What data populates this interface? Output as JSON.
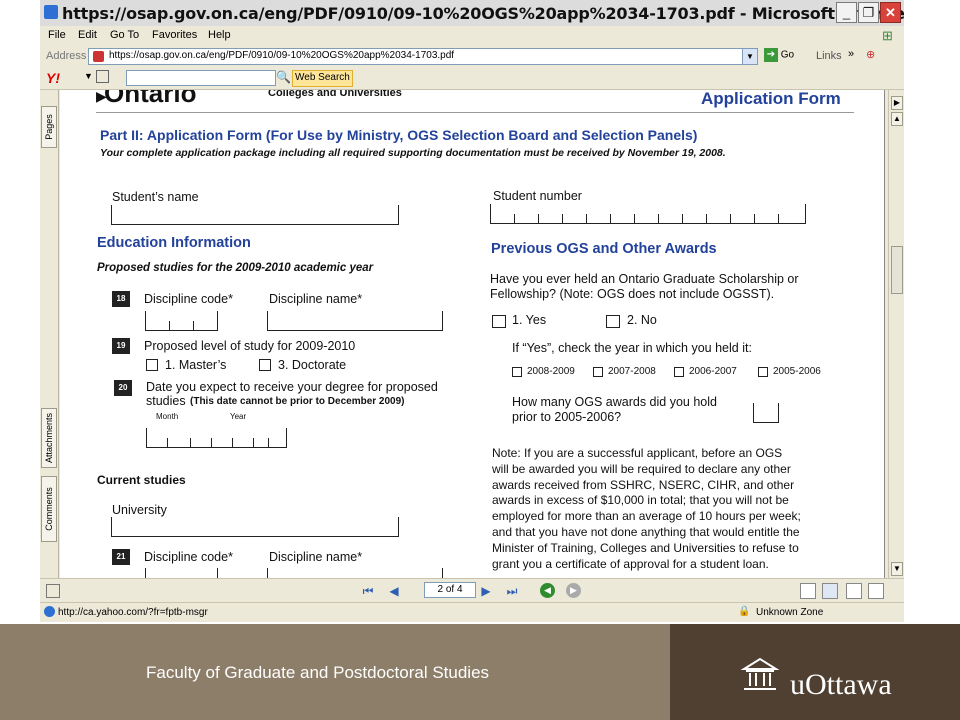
{
  "window": {
    "title": "https://osap.gov.on.ca/eng/PDF/0910/09-10%20OGS%20app%2034-1703.pdf - Microsoft Internet Ex...",
    "buttons": {
      "minimize": "_",
      "maximize": "❐",
      "close": "✕"
    }
  },
  "menubar": {
    "items": [
      {
        "label": "File"
      },
      {
        "label": "Edit"
      },
      {
        "label": "Go To"
      },
      {
        "label": "Favorites"
      },
      {
        "label": "Help"
      }
    ]
  },
  "address": {
    "label": "Address",
    "url": "https://osap.gov.on.ca/eng/PDF/0910/09-10%20OGS%20app%2034-1703.pdf",
    "go": "Go",
    "links": "Links"
  },
  "yahoo": {
    "logo": "Y!",
    "web_search": "Web Search"
  },
  "sidebar": {
    "tabs": [
      "Pages",
      "Attachments",
      "Comments"
    ]
  },
  "document": {
    "header_org_partial": "Ontario",
    "header_sub": "Colleges and Universities",
    "form_title": "Application Form",
    "part_title": "Part II:  Application Form (For Use by Ministry, OGS Selection Board and Selection Panels)",
    "deadline": "Your complete application package including all required supporting documentation must be received by November 19, 2008.",
    "students_name": "Student’s name",
    "student_number": "Student number",
    "education_heading": "Education Information",
    "proposed_heading": "Proposed studies for the 2009-2010 academic year",
    "q18": "18",
    "discipline_code": "Discipline code*",
    "discipline_name": "Discipline name*",
    "q19": "19",
    "proposed_level": "Proposed level of study for 2009-2010",
    "level_opt1": "1. Master’s",
    "level_opt3": "3. Doctorate",
    "q20": "20",
    "date_expect_1": "Date you expect to receive your degree for proposed",
    "date_expect_2a": "studies",
    "date_expect_2b": "(This date cannot be prior to December 2009)",
    "month": "Month",
    "year": "Year",
    "current_heading": "Current studies",
    "university": "University",
    "q21": "21",
    "awards_heading": "Previous OGS and Other Awards",
    "awards_q1": "Have you ever held an Ontario Graduate Scholarship or",
    "awards_q2": "Fellowship? (Note: OGS does not include OGSST).",
    "yes_label": "1. Yes",
    "no_label": "2. No",
    "if_yes": "If “Yes”, check the year in which you held it:",
    "years": [
      "2008-2009",
      "2007-2008",
      "2006-2007",
      "2005-2006"
    ],
    "how_many_1": "How many OGS awards did you hold",
    "how_many_2": "prior to 2005-2006?",
    "note_lines": [
      "Note:  If you are a successful applicant, before an OGS",
      "will be awarded you will be required to declare any other",
      "awards received from SSHRC, NSERC, CIHR, and other",
      "awards in excess of $10,000 in total; that you will not be",
      "employed for more than an average of 10 hours per week;",
      "and that you have not done anything that would entitle the",
      "Minister of Training, Colleges and Universities to refuse to",
      "grant you a certificate of approval for a student loan."
    ]
  },
  "navigation": {
    "page_indicator": "2 of 4"
  },
  "status": {
    "url": "http://ca.yahoo.com/?fr=fptb-msgr",
    "zone": "Unknown Zone"
  },
  "footer": {
    "text": "Faculty of Graduate and Postdoctoral Studies",
    "logo_text": "uOttawa"
  }
}
